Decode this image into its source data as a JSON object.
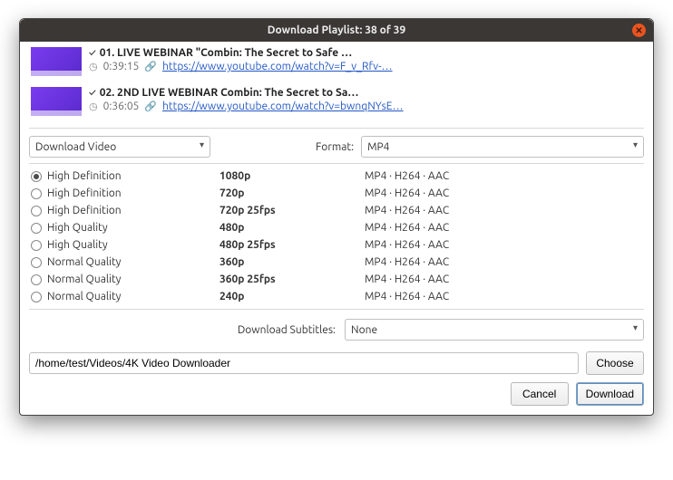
{
  "window": {
    "title": "Download Playlist: 38 of 39"
  },
  "playlist": [
    {
      "checked": true,
      "title": "01. LIVE WEBINAR \"Combin: The Secret to Safe …",
      "duration": "0:39:15",
      "url": "https://www.youtube.com/watch?v=F_v_Rfv-…"
    },
    {
      "checked": true,
      "title": "02. 2ND LIVE WEBINAR Combin: The Secret to Sa…",
      "duration": "0:36:05",
      "url": "https://www.youtube.com/watch?v=bwnqNYsE…"
    }
  ],
  "controls": {
    "action_label": "Download Video",
    "format_lbl": "Format:",
    "format_value": "MP4"
  },
  "qualities": [
    {
      "selected": true,
      "tier": "High Definition",
      "res": "1080p",
      "codec": "MP4 · H264 · AAC"
    },
    {
      "selected": false,
      "tier": "High Definition",
      "res": "720p",
      "codec": "MP4 · H264 · AAC"
    },
    {
      "selected": false,
      "tier": "High Definition",
      "res": "720p 25fps",
      "codec": "MP4 · H264 · AAC"
    },
    {
      "selected": false,
      "tier": "High Quality",
      "res": "480p",
      "codec": "MP4 · H264 · AAC"
    },
    {
      "selected": false,
      "tier": "High Quality",
      "res": "480p 25fps",
      "codec": "MP4 · H264 · AAC"
    },
    {
      "selected": false,
      "tier": "Normal Quality",
      "res": "360p",
      "codec": "MP4 · H264 · AAC"
    },
    {
      "selected": false,
      "tier": "Normal Quality",
      "res": "360p 25fps",
      "codec": "MP4 · H264 · AAC"
    },
    {
      "selected": false,
      "tier": "Normal Quality",
      "res": "240p",
      "codec": "MP4 · H264 · AAC"
    }
  ],
  "subtitles": {
    "label": "Download Subtitles:",
    "value": "None"
  },
  "path": {
    "value": "/home/test/Videos/4K Video Downloader",
    "choose_label": "Choose"
  },
  "actions": {
    "cancel": "Cancel",
    "download": "Download"
  },
  "icons": {
    "check": "✓",
    "clock": "◷",
    "link": "🔗",
    "close": "✕"
  }
}
